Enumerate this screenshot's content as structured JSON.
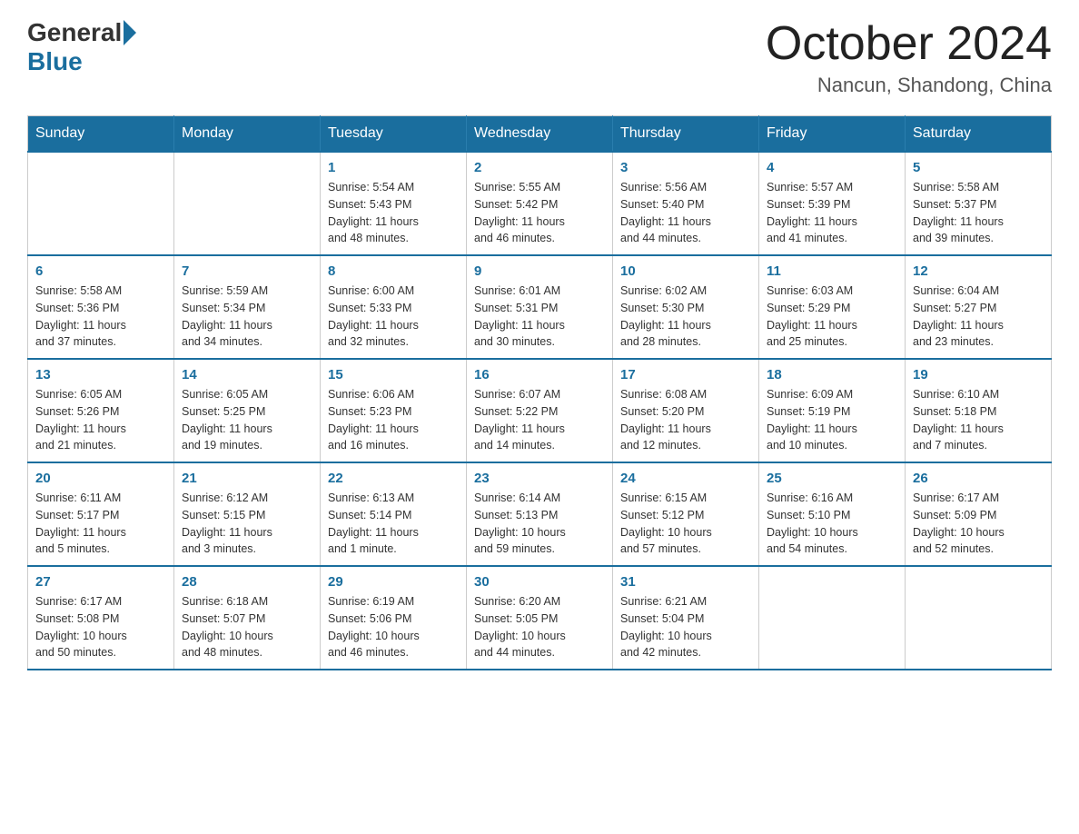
{
  "header": {
    "logo_general": "General",
    "logo_blue": "Blue",
    "month_title": "October 2024",
    "location": "Nancun, Shandong, China"
  },
  "days_of_week": [
    "Sunday",
    "Monday",
    "Tuesday",
    "Wednesday",
    "Thursday",
    "Friday",
    "Saturday"
  ],
  "weeks": [
    [
      {
        "day": "",
        "info": ""
      },
      {
        "day": "",
        "info": ""
      },
      {
        "day": "1",
        "info": "Sunrise: 5:54 AM\nSunset: 5:43 PM\nDaylight: 11 hours\nand 48 minutes."
      },
      {
        "day": "2",
        "info": "Sunrise: 5:55 AM\nSunset: 5:42 PM\nDaylight: 11 hours\nand 46 minutes."
      },
      {
        "day": "3",
        "info": "Sunrise: 5:56 AM\nSunset: 5:40 PM\nDaylight: 11 hours\nand 44 minutes."
      },
      {
        "day": "4",
        "info": "Sunrise: 5:57 AM\nSunset: 5:39 PM\nDaylight: 11 hours\nand 41 minutes."
      },
      {
        "day": "5",
        "info": "Sunrise: 5:58 AM\nSunset: 5:37 PM\nDaylight: 11 hours\nand 39 minutes."
      }
    ],
    [
      {
        "day": "6",
        "info": "Sunrise: 5:58 AM\nSunset: 5:36 PM\nDaylight: 11 hours\nand 37 minutes."
      },
      {
        "day": "7",
        "info": "Sunrise: 5:59 AM\nSunset: 5:34 PM\nDaylight: 11 hours\nand 34 minutes."
      },
      {
        "day": "8",
        "info": "Sunrise: 6:00 AM\nSunset: 5:33 PM\nDaylight: 11 hours\nand 32 minutes."
      },
      {
        "day": "9",
        "info": "Sunrise: 6:01 AM\nSunset: 5:31 PM\nDaylight: 11 hours\nand 30 minutes."
      },
      {
        "day": "10",
        "info": "Sunrise: 6:02 AM\nSunset: 5:30 PM\nDaylight: 11 hours\nand 28 minutes."
      },
      {
        "day": "11",
        "info": "Sunrise: 6:03 AM\nSunset: 5:29 PM\nDaylight: 11 hours\nand 25 minutes."
      },
      {
        "day": "12",
        "info": "Sunrise: 6:04 AM\nSunset: 5:27 PM\nDaylight: 11 hours\nand 23 minutes."
      }
    ],
    [
      {
        "day": "13",
        "info": "Sunrise: 6:05 AM\nSunset: 5:26 PM\nDaylight: 11 hours\nand 21 minutes."
      },
      {
        "day": "14",
        "info": "Sunrise: 6:05 AM\nSunset: 5:25 PM\nDaylight: 11 hours\nand 19 minutes."
      },
      {
        "day": "15",
        "info": "Sunrise: 6:06 AM\nSunset: 5:23 PM\nDaylight: 11 hours\nand 16 minutes."
      },
      {
        "day": "16",
        "info": "Sunrise: 6:07 AM\nSunset: 5:22 PM\nDaylight: 11 hours\nand 14 minutes."
      },
      {
        "day": "17",
        "info": "Sunrise: 6:08 AM\nSunset: 5:20 PM\nDaylight: 11 hours\nand 12 minutes."
      },
      {
        "day": "18",
        "info": "Sunrise: 6:09 AM\nSunset: 5:19 PM\nDaylight: 11 hours\nand 10 minutes."
      },
      {
        "day": "19",
        "info": "Sunrise: 6:10 AM\nSunset: 5:18 PM\nDaylight: 11 hours\nand 7 minutes."
      }
    ],
    [
      {
        "day": "20",
        "info": "Sunrise: 6:11 AM\nSunset: 5:17 PM\nDaylight: 11 hours\nand 5 minutes."
      },
      {
        "day": "21",
        "info": "Sunrise: 6:12 AM\nSunset: 5:15 PM\nDaylight: 11 hours\nand 3 minutes."
      },
      {
        "day": "22",
        "info": "Sunrise: 6:13 AM\nSunset: 5:14 PM\nDaylight: 11 hours\nand 1 minute."
      },
      {
        "day": "23",
        "info": "Sunrise: 6:14 AM\nSunset: 5:13 PM\nDaylight: 10 hours\nand 59 minutes."
      },
      {
        "day": "24",
        "info": "Sunrise: 6:15 AM\nSunset: 5:12 PM\nDaylight: 10 hours\nand 57 minutes."
      },
      {
        "day": "25",
        "info": "Sunrise: 6:16 AM\nSunset: 5:10 PM\nDaylight: 10 hours\nand 54 minutes."
      },
      {
        "day": "26",
        "info": "Sunrise: 6:17 AM\nSunset: 5:09 PM\nDaylight: 10 hours\nand 52 minutes."
      }
    ],
    [
      {
        "day": "27",
        "info": "Sunrise: 6:17 AM\nSunset: 5:08 PM\nDaylight: 10 hours\nand 50 minutes."
      },
      {
        "day": "28",
        "info": "Sunrise: 6:18 AM\nSunset: 5:07 PM\nDaylight: 10 hours\nand 48 minutes."
      },
      {
        "day": "29",
        "info": "Sunrise: 6:19 AM\nSunset: 5:06 PM\nDaylight: 10 hours\nand 46 minutes."
      },
      {
        "day": "30",
        "info": "Sunrise: 6:20 AM\nSunset: 5:05 PM\nDaylight: 10 hours\nand 44 minutes."
      },
      {
        "day": "31",
        "info": "Sunrise: 6:21 AM\nSunset: 5:04 PM\nDaylight: 10 hours\nand 42 minutes."
      },
      {
        "day": "",
        "info": ""
      },
      {
        "day": "",
        "info": ""
      }
    ]
  ]
}
